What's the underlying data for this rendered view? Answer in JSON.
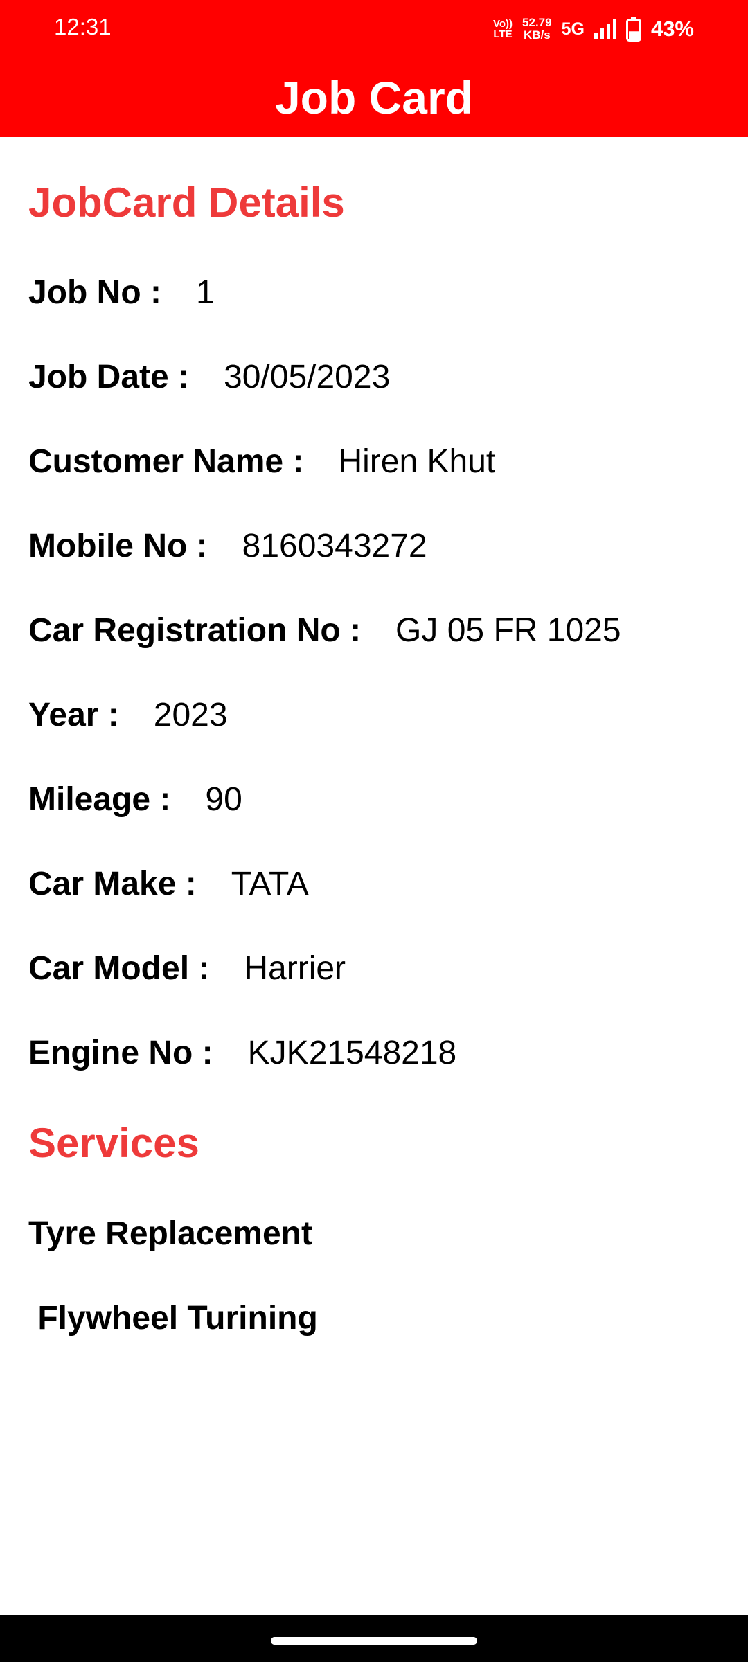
{
  "status_bar": {
    "time": "12:31",
    "volte_top": "Vo))",
    "volte_bottom": "LTE",
    "speed_value": "52.79",
    "speed_unit": "KB/s",
    "network": "5G",
    "battery": "43%",
    "signal_level": 4,
    "battery_level": 0.43
  },
  "header": {
    "title": "Job Card",
    "color": "#ff0000"
  },
  "details_section": {
    "heading": "JobCard Details",
    "heading_color": "#ee3a3a",
    "fields": [
      {
        "label": "Job No :",
        "value": "1"
      },
      {
        "label": "Job Date :",
        "value": "30/05/2023"
      },
      {
        "label": "Customer Name :",
        "value": "Hiren Khut"
      },
      {
        "label": "Mobile No :",
        "value": "8160343272"
      },
      {
        "label": "Car Registration No :",
        "value": "GJ 05 FR 1025"
      },
      {
        "label": "Year :",
        "value": "2023"
      },
      {
        "label": "Mileage :",
        "value": "90"
      },
      {
        "label": "Car Make :",
        "value": "TATA"
      },
      {
        "label": "Car Model :",
        "value": "Harrier"
      },
      {
        "label": "Engine No :",
        "value": "KJK21548218"
      }
    ]
  },
  "services_section": {
    "heading": "Services",
    "items": [
      "Tyre Replacement",
      " Flywheel Turining"
    ]
  }
}
